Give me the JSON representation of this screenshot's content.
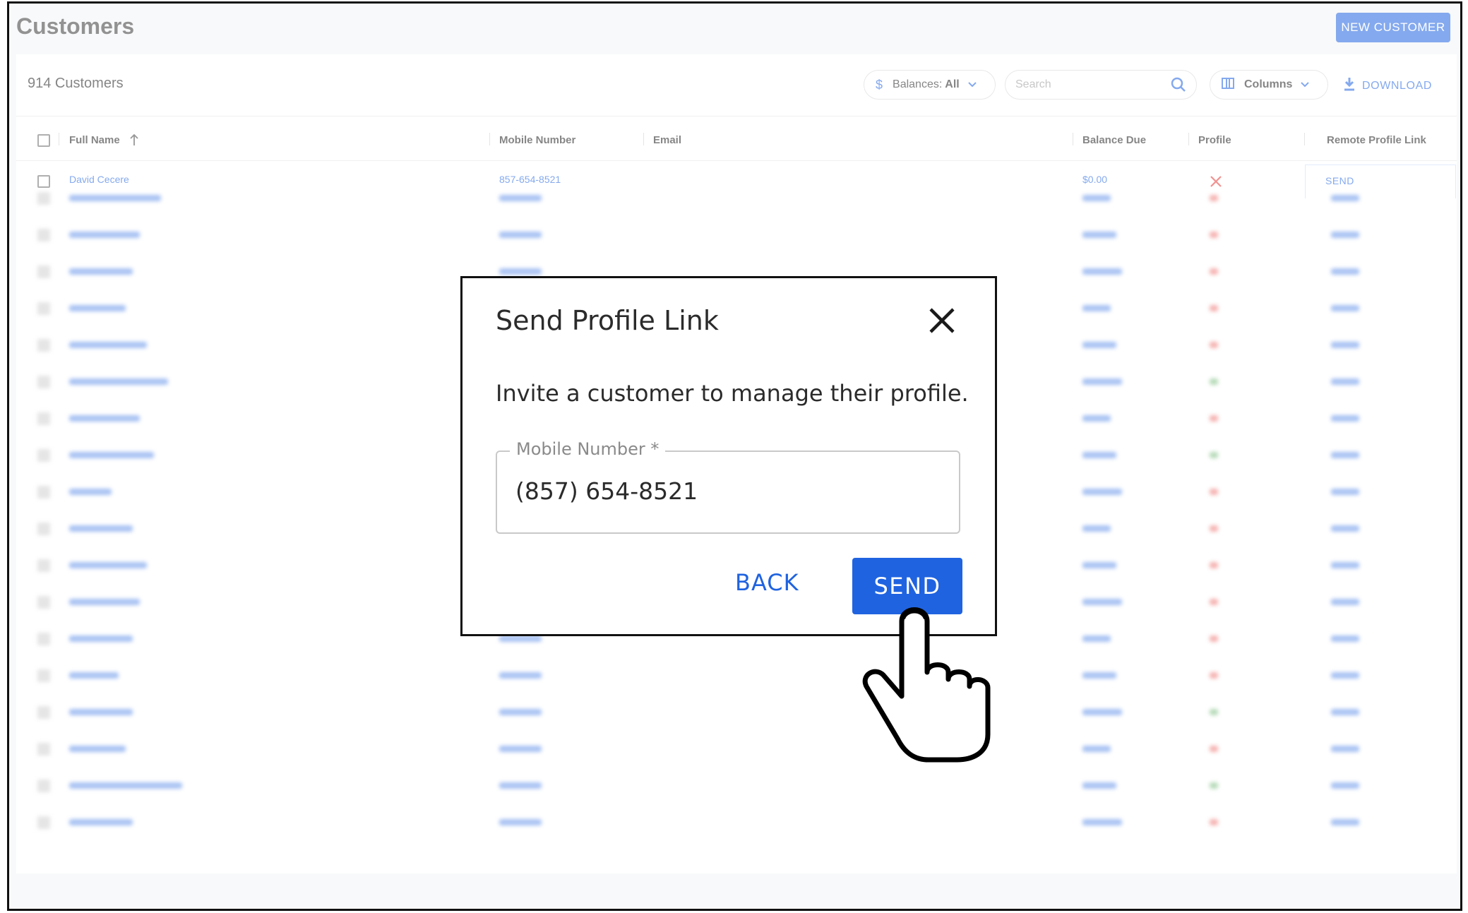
{
  "header": {
    "title": "Customers",
    "new_customer_label": "NEW CUSTOMER"
  },
  "toolbar": {
    "count_label": "914 Customers",
    "balances_prefix": "Balances:",
    "balances_value": "All",
    "search_placeholder": "Search",
    "columns_label": "Columns",
    "download_label": "DOWNLOAD"
  },
  "table": {
    "columns": [
      "Full Name",
      "Mobile Number",
      "Email",
      "Balance Due",
      "Profile",
      "Remote Profile Link"
    ],
    "rows": [
      {
        "name": "David Cecere",
        "mobile": "857-654-8521",
        "email": "",
        "balance": "$0.00",
        "profile": "x-icon",
        "link": "SEND"
      }
    ]
  },
  "dialog": {
    "title": "Send Profile Link",
    "message": "Invite a customer to manage their profile.",
    "field_label": "Mobile Number *",
    "field_value": "(857) 654-8521",
    "back_label": "BACK",
    "send_label": "SEND"
  },
  "colors": {
    "accent": "#1f63e0",
    "error": "#e53935",
    "success": "#43a047"
  }
}
